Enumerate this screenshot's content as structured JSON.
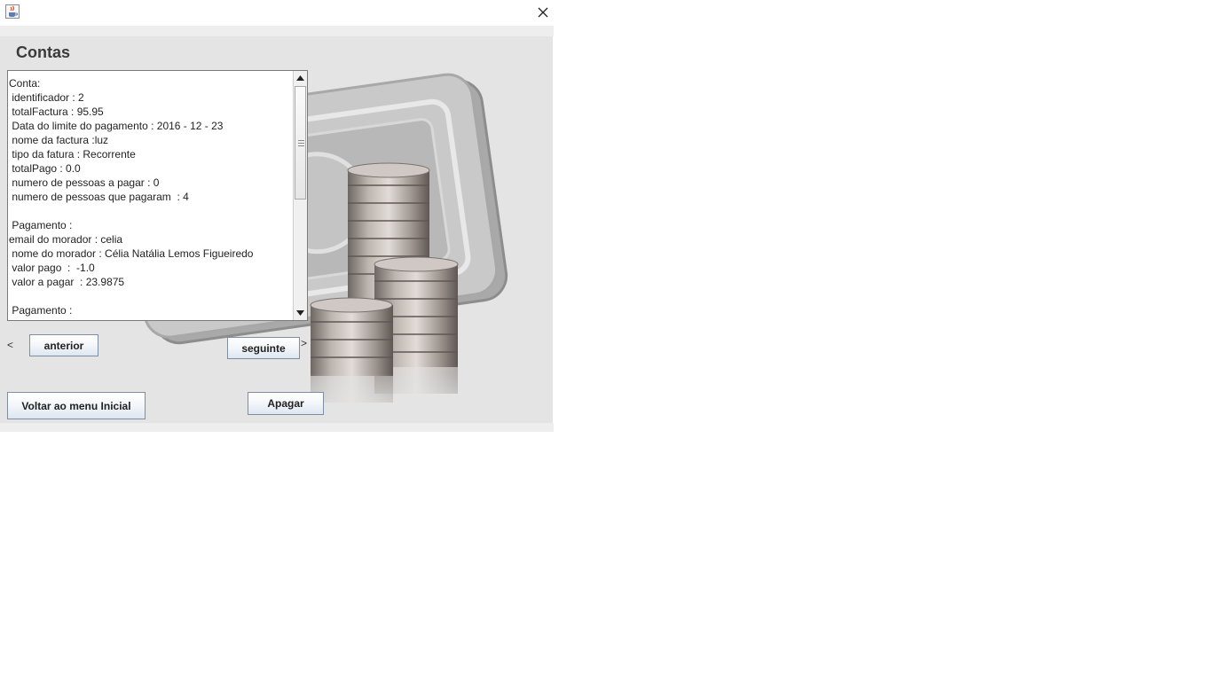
{
  "window": {
    "icon": "java-cup-icon",
    "close_icon": "close-icon"
  },
  "page": {
    "title": "Contas"
  },
  "details": {
    "lines": [
      "Conta:",
      " identificador : 2",
      " totalFactura : 95.95",
      " Data do limite do pagamento : 2016 - 12 - 23",
      " nome da factura :luz",
      " tipo da fatura : Recorrente",
      " totalPago : 0.0",
      " numero de pessoas a pagar : 0",
      " numero de pessoas que pagaram  : 4",
      "",
      " Pagamento :",
      "email do morador : celia",
      " nome do morador : Célia Natália Lemos Figueiredo",
      " valor pago  :  -1.0",
      " valor a pagar  : 23.9875",
      "",
      " Pagamento :"
    ]
  },
  "nav": {
    "prev_symbol": "<",
    "prev_label": "anterior",
    "next_label": "seguinte",
    "next_symbol": ">"
  },
  "actions": {
    "back_label": "Voltar ao menu Inicial",
    "delete_label": "Apagar"
  },
  "colors": {
    "background": "#e4e4e4",
    "button_border": "#7e8fa3"
  }
}
